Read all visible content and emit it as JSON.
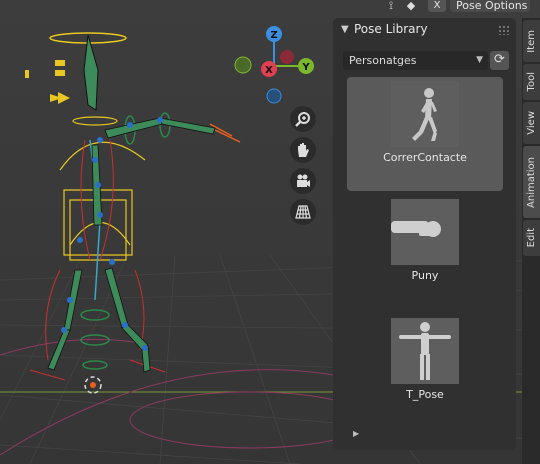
{
  "header": {
    "pose_options_label": "Pose Options",
    "close_label": "X"
  },
  "gizmo": {
    "z_label": "Z",
    "x_label": "X",
    "y_label": "Y"
  },
  "panel": {
    "title": "Pose Library",
    "library_select": "Personatges",
    "poses": [
      {
        "label": "CorrerContacte",
        "selected": true
      },
      {
        "label": "Puny",
        "selected": false
      },
      {
        "label": "T_Pose",
        "selected": false
      }
    ]
  },
  "sidebar_tabs": [
    "Item",
    "Tool",
    "View",
    "Animation",
    "Edit"
  ],
  "colors": {
    "axis_x": "#e04050",
    "axis_y": "#7cb82c",
    "axis_z": "#3b8ee0",
    "bone": "#3d8a5a",
    "selection": "#e8c820"
  }
}
